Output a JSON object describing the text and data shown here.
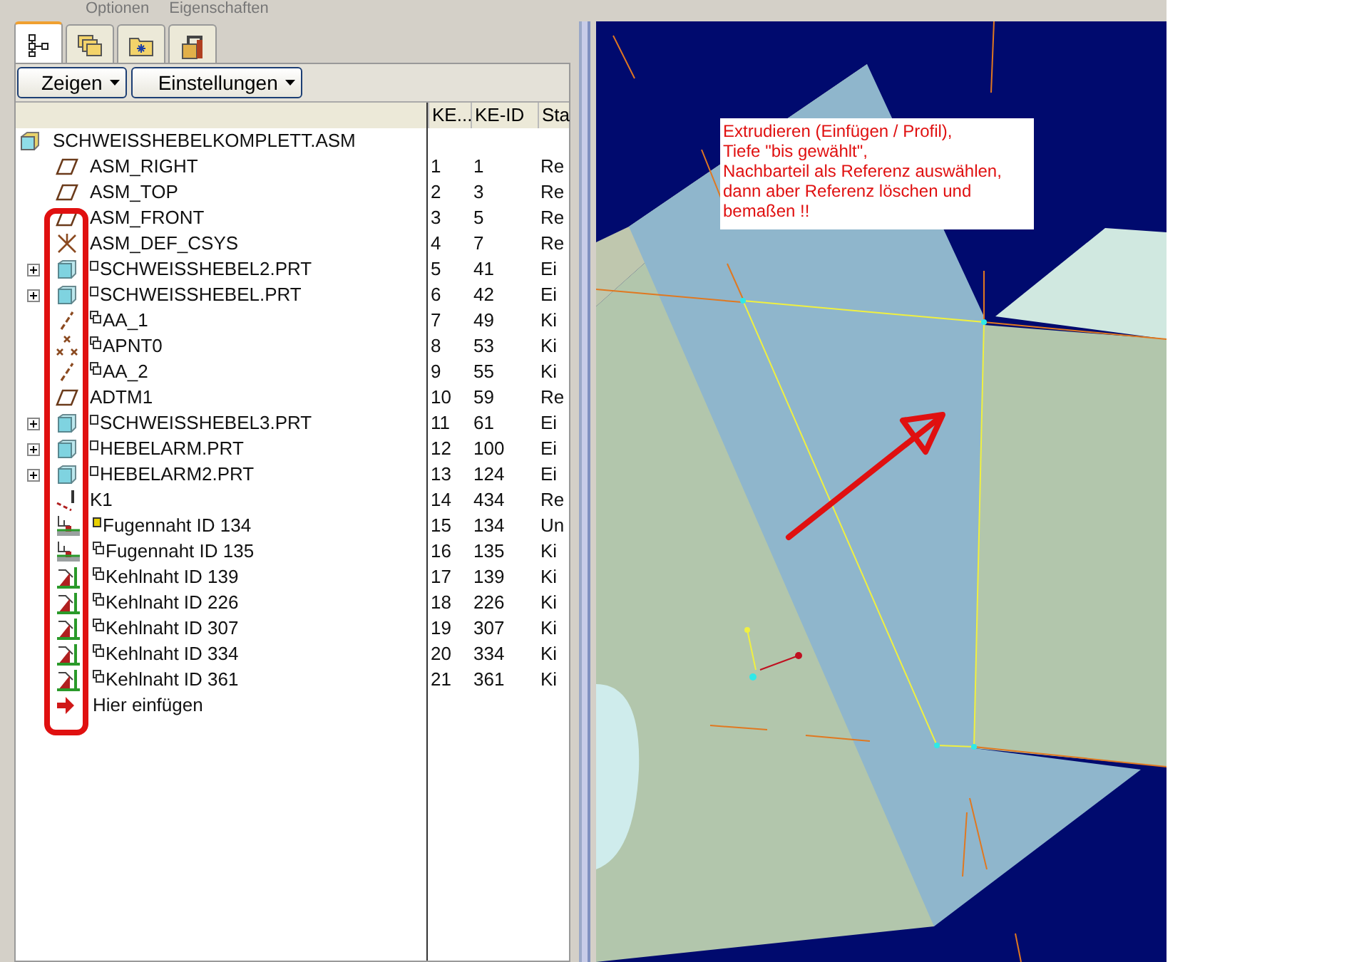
{
  "menu": [
    "Optionen",
    "Eigenschaften"
  ],
  "tabs": [
    {
      "selected": true
    },
    {
      "selected": false
    },
    {
      "selected": false
    },
    {
      "selected": false
    }
  ],
  "buttons": [
    "Zeigen",
    "Einstellungen"
  ],
  "table": {
    "columns": [
      "KE...",
      "KE-ID",
      "Sta"
    ],
    "root": {
      "name": "SCHWEISSHEBELKOMPLETT.ASM",
      "kind": "assembly",
      "children": [
        {
          "name": "ASM_RIGHT",
          "kind": "plane",
          "ke": "1",
          "id": "1",
          "status": "Re"
        },
        {
          "name": "ASM_TOP",
          "kind": "plane",
          "ke": "2",
          "id": "3",
          "status": "Re"
        },
        {
          "name": "ASM_FRONT",
          "kind": "plane",
          "ke": "3",
          "id": "5",
          "status": "Re"
        },
        {
          "name": "ASM_DEF_CSYS",
          "kind": "csys",
          "ke": "4",
          "id": "7",
          "status": "Re"
        },
        {
          "name": "SCHWEISSHEBEL2.PRT",
          "kind": "part",
          "copied": false,
          "expanded": false,
          "ke": "5",
          "id": "41",
          "status": "Ei"
        },
        {
          "name": "SCHWEISSHEBEL.PRT",
          "kind": "part",
          "copied": false,
          "expanded": false,
          "ke": "6",
          "id": "42",
          "status": "Ei"
        },
        {
          "name": "AA_1",
          "kind": "axis",
          "copied": true,
          "ke": "7",
          "id": "49",
          "status": "Ki"
        },
        {
          "name": "APNT0",
          "kind": "point",
          "copied": true,
          "ke": "8",
          "id": "53",
          "status": "Ki"
        },
        {
          "name": "AA_2",
          "kind": "axis",
          "copied": true,
          "ke": "9",
          "id": "55",
          "status": "Ki"
        },
        {
          "name": "ADTM1",
          "kind": "plane",
          "ke": "10",
          "id": "59",
          "status": "Re"
        },
        {
          "name": "SCHWEISSHEBEL3.PRT",
          "kind": "part",
          "copied": false,
          "expanded": false,
          "ke": "11",
          "id": "61",
          "status": "Ei"
        },
        {
          "name": "HEBELARM.PRT",
          "kind": "part",
          "copied": false,
          "expanded": false,
          "ke": "12",
          "id": "100",
          "status": "Ei"
        },
        {
          "name": "HEBELARM2.PRT",
          "kind": "part",
          "copied": false,
          "expanded": false,
          "ke": "13",
          "id": "124",
          "status": "Ei"
        },
        {
          "name": "K1",
          "kind": "curve",
          "ke": "14",
          "id": "434",
          "status": "Re"
        },
        {
          "name": "Fugennaht ID 134",
          "kind": "groove-weld",
          "copied": false,
          "incomplete": true,
          "ke": "15",
          "id": "134",
          "status": "Un"
        },
        {
          "name": "Fugennaht ID 135",
          "kind": "groove-weld",
          "copied": true,
          "incomplete": false,
          "ke": "16",
          "id": "135",
          "status": "Ki"
        },
        {
          "name": "Kehlnaht ID 139",
          "kind": "fillet-weld",
          "copied": true,
          "ke": "17",
          "id": "139",
          "status": "Ki"
        },
        {
          "name": "Kehlnaht ID 226",
          "kind": "fillet-weld",
          "copied": true,
          "ke": "18",
          "id": "226",
          "status": "Ki"
        },
        {
          "name": "Kehlnaht ID 307",
          "kind": "fillet-weld",
          "copied": true,
          "ke": "19",
          "id": "307",
          "status": "Ki"
        },
        {
          "name": "Kehlnaht ID 334",
          "kind": "fillet-weld",
          "copied": true,
          "ke": "20",
          "id": "334",
          "status": "Ki"
        },
        {
          "name": "Kehlnaht ID 361",
          "kind": "fillet-weld",
          "copied": true,
          "ke": "21",
          "id": "361",
          "status": "Ki"
        },
        {
          "name": "Hier einfügen",
          "kind": "insert"
        }
      ]
    }
  },
  "note": {
    "lines": [
      "Extrudieren (Einfügen / Profil),",
      "Tiefe \"bis gewählt\",",
      "Nachbarteil als Referenz auswählen,",
      "dann aber Referenz löschen und",
      "bemaßen !!"
    ]
  }
}
